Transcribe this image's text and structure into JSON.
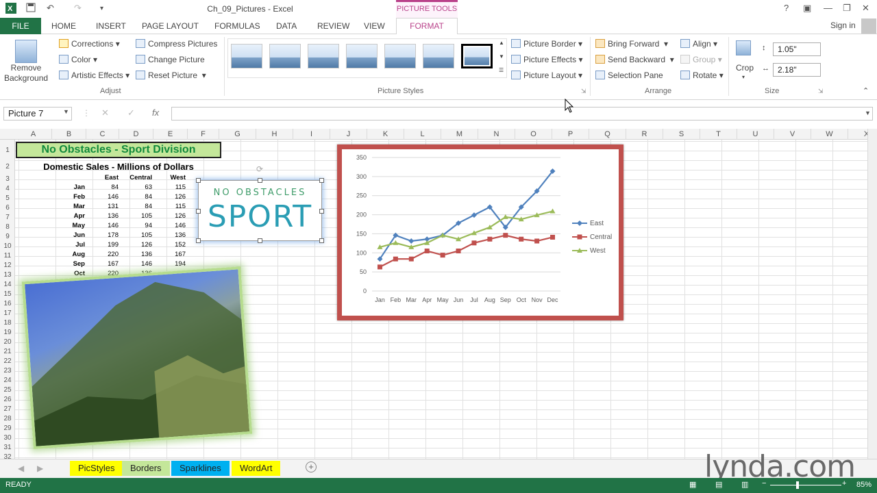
{
  "window": {
    "title": "Ch_09_Pictures - Excel",
    "context_tab": "PICTURE TOOLS",
    "signin": "Sign in"
  },
  "tabs": [
    "FILE",
    "HOME",
    "INSERT",
    "PAGE LAYOUT",
    "FORMULAS",
    "DATA",
    "REVIEW",
    "VIEW",
    "FORMAT"
  ],
  "ribbon": {
    "remove_background": "Remove Background",
    "adjust": {
      "corrections": "Corrections",
      "color": "Color",
      "artistic_effects": "Artistic Effects",
      "compress": "Compress Pictures",
      "change": "Change Picture",
      "reset": "Reset Picture",
      "label": "Adjust"
    },
    "styles": {
      "label": "Picture Styles",
      "border": "Picture Border",
      "effects": "Picture Effects",
      "layout": "Picture Layout"
    },
    "arrange": {
      "bring_forward": "Bring Forward",
      "send_backward": "Send Backward",
      "selection_pane": "Selection Pane",
      "align": "Align",
      "group": "Group",
      "rotate": "Rotate",
      "label": "Arrange"
    },
    "size": {
      "crop": "Crop",
      "height": "1.05\"",
      "width": "2.18\"",
      "label": "Size"
    }
  },
  "formula_bar": {
    "name_box": "Picture 7",
    "fx": "fx",
    "value": ""
  },
  "columns": [
    "A",
    "B",
    "C",
    "D",
    "E",
    "F",
    "G",
    "H",
    "I",
    "J",
    "K",
    "L",
    "M",
    "N",
    "O",
    "P",
    "Q",
    "R",
    "S",
    "T",
    "U",
    "V",
    "W",
    "X"
  ],
  "rows": [
    "1",
    "2",
    "3",
    "4",
    "5",
    "6",
    "7",
    "8",
    "9",
    "10",
    "11",
    "12",
    "13",
    "14",
    "15",
    "16",
    "17",
    "18",
    "19",
    "20",
    "21",
    "22",
    "23",
    "24",
    "25",
    "26",
    "27",
    "28",
    "29",
    "30",
    "31",
    "32"
  ],
  "sheet": {
    "title": "No Obstacles - Sport Division",
    "subtitle": "Domestic Sales - Millions of Dollars",
    "headers": [
      "East",
      "Central",
      "West"
    ],
    "rows": [
      {
        "month": "Jan",
        "east": "84",
        "central": "63",
        "west": "115"
      },
      {
        "month": "Feb",
        "east": "146",
        "central": "84",
        "west": "126"
      },
      {
        "month": "Mar",
        "east": "131",
        "central": "84",
        "west": "115"
      },
      {
        "month": "Apr",
        "east": "136",
        "central": "105",
        "west": "126"
      },
      {
        "month": "May",
        "east": "146",
        "central": "94",
        "west": "146"
      },
      {
        "month": "Jun",
        "east": "178",
        "central": "105",
        "west": "136"
      },
      {
        "month": "Jul",
        "east": "199",
        "central": "126",
        "west": "152"
      },
      {
        "month": "Aug",
        "east": "220",
        "central": "136",
        "west": "167"
      },
      {
        "month": "Sep",
        "east": "167",
        "central": "146",
        "west": "194"
      },
      {
        "month": "Oct",
        "east": "220",
        "central": "136",
        "west": ""
      }
    ]
  },
  "logo": {
    "top": "NO OBSTACLES",
    "main": "SPORT"
  },
  "chart_data": {
    "type": "line",
    "categories": [
      "Jan",
      "Feb",
      "Mar",
      "Apr",
      "May",
      "Jun",
      "Jul",
      "Aug",
      "Sep",
      "Oct",
      "Nov",
      "Dec"
    ],
    "series": [
      {
        "name": "East",
        "color": "#4f81bd",
        "values": [
          84,
          146,
          131,
          136,
          146,
          178,
          199,
          220,
          167,
          220,
          262,
          314
        ]
      },
      {
        "name": "Central",
        "color": "#c0504d",
        "values": [
          63,
          84,
          84,
          105,
          94,
          105,
          126,
          136,
          146,
          136,
          131,
          141
        ]
      },
      {
        "name": "West",
        "color": "#9bbb59",
        "values": [
          115,
          126,
          115,
          126,
          146,
          136,
          152,
          167,
          194,
          188,
          199,
          209
        ]
      }
    ],
    "yticks": [
      0,
      50,
      100,
      150,
      200,
      250,
      300,
      350
    ],
    "ylim": [
      0,
      350
    ],
    "legend": "right",
    "border_color": "#c0504d"
  },
  "sheet_tabs": [
    {
      "label": "PicStyles",
      "color": "#ffff00"
    },
    {
      "label": "Borders",
      "color": "#c4e79a"
    },
    {
      "label": "Sparklines",
      "color": "#00b0f0"
    },
    {
      "label": "WordArt",
      "color": "#ffff00"
    }
  ],
  "status": {
    "ready": "READY",
    "zoom": "85%"
  },
  "watermark": "lynda.com"
}
